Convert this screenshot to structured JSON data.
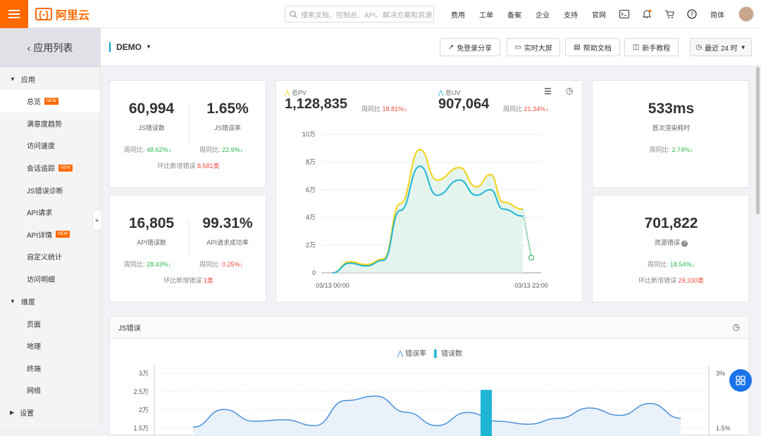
{
  "brand": {
    "name": "阿里云",
    "mark": "(-)"
  },
  "search": {
    "placeholder": "搜索文档、控制台、API、解决方案和资源"
  },
  "topnav": [
    "费用",
    "工单",
    "备案",
    "企业",
    "支持",
    "官网"
  ],
  "lang": "简体",
  "sidebar": {
    "back_label": "应用列表",
    "group1": "应用",
    "items": [
      {
        "label": "总览",
        "badge": "NEW"
      },
      {
        "label": "满意度趋势"
      },
      {
        "label": "访问速度"
      },
      {
        "label": "会话追踪",
        "badge": "NEW"
      },
      {
        "label": "JS错误诊断"
      },
      {
        "label": "API请求"
      },
      {
        "label": "API详情",
        "badge": "NEW"
      },
      {
        "label": "自定义统计"
      },
      {
        "label": "访问明细"
      }
    ],
    "group2": "维度",
    "dims": [
      "页面",
      "地理",
      "终端",
      "网络"
    ],
    "group3": "设置"
  },
  "subhead": {
    "app": "DEMO",
    "buttons": [
      "免登录分享",
      "实时大屏",
      "帮助文档",
      "新手教程"
    ],
    "range": "最近 24 时"
  },
  "stats": {
    "js_err": {
      "value": "60,994",
      "label": "JS错误数",
      "wow_label": "周同比:",
      "wow": "48.62%"
    },
    "js_rate": {
      "value": "1.65%",
      "label": "JS错误率",
      "wow_label": "周同比:",
      "wow": "22.9%"
    },
    "js_new": {
      "label": "环比新增错误",
      "value": "8,581类"
    },
    "api_err": {
      "value": "16,805",
      "label": "API错误数",
      "wow_label": "周同比:",
      "wow": "28.43%"
    },
    "api_rate": {
      "value": "99.31%",
      "label": "API请求成功率",
      "wow_label": "周同比:",
      "wow": "0.25%"
    },
    "api_new": {
      "label": "环比新增错误",
      "value": "1类"
    },
    "render": {
      "value": "533ms",
      "label": "首次渲染耗时",
      "wow_label": "周同比:",
      "wow": "2.74%"
    },
    "res": {
      "value": "701,822",
      "label": "资源错误",
      "wow_label": "周同比:",
      "wow": "18.54%"
    },
    "res_new": {
      "label": "环比新增错误",
      "value": "29,330类"
    }
  },
  "pvuv": {
    "pv_label": "总PV",
    "pv": "1,128,835",
    "pv_wow_label": "周同比",
    "pv_wow": "18.81%",
    "uv_label": "总UV",
    "uv": "907,064",
    "uv_wow_label": "周同比",
    "uv_wow": "21.34%"
  },
  "jserr_panel": {
    "title": "JS错误",
    "legend_rate": "错误率",
    "legend_count": "错误数"
  },
  "colors": {
    "accent": "#ff6a00",
    "pv": "#f5d313",
    "uv": "#1fb5d4",
    "err": "#4a90d9"
  },
  "chart_data": [
    {
      "type": "area",
      "x_ticks": [
        "03/13 00:00",
        "03/13 23:00"
      ],
      "y_ticks": [
        "0",
        "2万",
        "4万",
        "6万",
        "8万",
        "10万"
      ],
      "ylim": [
        0,
        100000
      ],
      "series": [
        {
          "name": "总PV",
          "values": [
            0,
            8000,
            6000,
            10000,
            50000,
            89000,
            67000,
            76000,
            62000,
            71000,
            51000,
            46000,
            12000
          ]
        },
        {
          "name": "总UV",
          "values": [
            0,
            7000,
            5000,
            9000,
            45000,
            77000,
            56000,
            67000,
            56000,
            60000,
            46000,
            41000,
            11000
          ]
        }
      ]
    },
    {
      "type": "line",
      "y_ticks_left": [
        "1.5万",
        "2万",
        "2.5万",
        "3万"
      ],
      "y_ticks_right": [
        "1.5%",
        "3%"
      ],
      "series": [
        {
          "name": "错误率",
          "values": [
            1.3,
            1.9,
            1.5,
            1.55,
            1.35,
            2.2,
            2.35,
            1.8,
            1.35,
            1.8,
            1.5,
            1.4,
            1.6,
            1.95,
            1.7,
            2.1,
            1.6
          ]
        },
        {
          "name": "错误数",
          "values": [
            0,
            0,
            0,
            0,
            0,
            0,
            0,
            0,
            0,
            25500,
            0,
            0,
            0,
            0,
            0,
            0,
            0
          ]
        }
      ]
    }
  ]
}
